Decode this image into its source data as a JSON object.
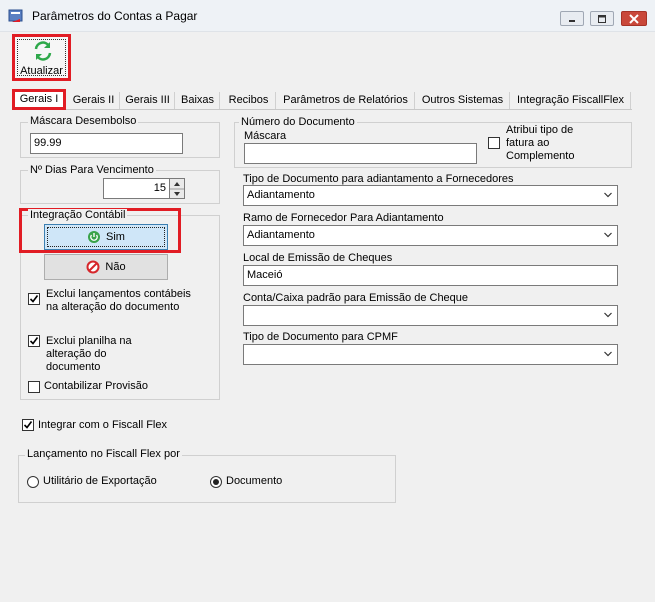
{
  "window": {
    "title": "Parâmetros do Contas a Pagar"
  },
  "toolbar": {
    "refresh_label": "Atualizar"
  },
  "tabs": [
    {
      "label": "Gerais I",
      "active": true
    },
    {
      "label": "Gerais II"
    },
    {
      "label": "Gerais III"
    },
    {
      "label": "Baixas"
    },
    {
      "label": "Recibos"
    },
    {
      "label": "Parâmetros de Relatórios"
    },
    {
      "label": "Outros Sistemas"
    },
    {
      "label": "Integração FiscallFlex"
    }
  ],
  "mascara_desembolso": {
    "label": "Máscara Desembolso",
    "value": "99.99"
  },
  "dias_vencimento": {
    "label": "Nº Dias Para Vencimento",
    "value": "15"
  },
  "integracao_contabil": {
    "label": "Integração Contábil",
    "sim_label": "Sim",
    "nao_label": "Não",
    "selected": "Sim",
    "checkboxes": [
      {
        "label": "Exclui lançamentos contábeis na alteração do documento",
        "checked": true
      },
      {
        "label": "Exclui planilha na alteração do documento",
        "checked": true
      },
      {
        "label": "Contabilizar Provisão",
        "checked": false
      }
    ]
  },
  "numero_documento": {
    "label": "Número do Documento",
    "mascara_label": "Máscara",
    "mascara_value": "",
    "atribui_label": "Atribui tipo de fatura ao Complemento",
    "atribui_checked": false
  },
  "tipo_doc_adiantamento": {
    "label": "Tipo de Documento para adiantamento a Fornecedores",
    "value": "Adiantamento"
  },
  "ramo_fornecedor": {
    "label": "Ramo de Fornecedor Para Adiantamento",
    "value": "Adiantamento"
  },
  "local_emissao": {
    "label": "Local de Emissão de Cheques",
    "value": "Maceió"
  },
  "conta_caixa": {
    "label": "Conta/Caixa padrão para Emissão de Cheque",
    "value": ""
  },
  "tipo_doc_cpmf": {
    "label": "Tipo de Documento para CPMF",
    "value": ""
  },
  "fiscall": {
    "integrar_label": "Integrar com o Fiscall Flex",
    "integrar_checked": true,
    "lancamento_label": "Lançamento no Fiscall Flex por",
    "options": [
      {
        "label": "Utilitário de Exportação",
        "selected": false
      },
      {
        "label": "Documento",
        "selected": true
      }
    ]
  },
  "colors": {
    "highlight_red": "#e11c24",
    "refresh_green": "#2ea84a",
    "sim_button_bg": "#cfe6f8",
    "power_green": "#3aa34a",
    "no_entry_red": "#d6262b",
    "window_close_red": "#c9483a"
  }
}
